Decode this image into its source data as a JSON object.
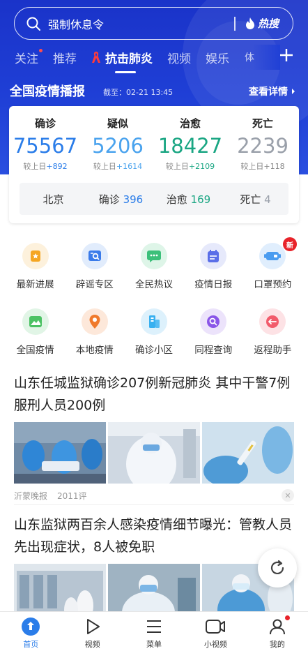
{
  "search": {
    "query": "强制休息令",
    "hot_label": "热搜"
  },
  "tabs": [
    {
      "label": "关注"
    },
    {
      "label": "推荐"
    },
    {
      "label": "抗击肺炎"
    },
    {
      "label": "视频"
    },
    {
      "label": "娱乐"
    },
    {
      "label": "体"
    }
  ],
  "report": {
    "title": "全国疫情播报",
    "timestamp": "截至：02-21 13:45",
    "more_label": "查看详情",
    "stats": [
      {
        "label": "确诊",
        "value": "75567",
        "delta_prefix": "较上日",
        "delta": "+892",
        "color": "#2b7de9"
      },
      {
        "label": "疑似",
        "value": "5206",
        "delta_prefix": "较上日",
        "delta": "+1614",
        "color": "#4aa3ee"
      },
      {
        "label": "治愈",
        "value": "18427",
        "delta_prefix": "较上日",
        "delta": "+2109",
        "color": "#1aa683"
      },
      {
        "label": "死亡",
        "value": "2239",
        "delta_prefix": "较上日",
        "delta": "+118",
        "color": "#9aa0aa"
      }
    ],
    "city": {
      "name": "北京",
      "confirmed_label": "确诊",
      "confirmed": "396",
      "cured_label": "治愈",
      "cured": "169",
      "dead_label": "死亡",
      "dead": "4"
    }
  },
  "features": [
    {
      "label": "最新进展",
      "icon": "bookmark-icon",
      "color": "#f5a623"
    },
    {
      "label": "辟谣专区",
      "icon": "search-doc-icon",
      "color": "#3a7bea"
    },
    {
      "label": "全民热议",
      "icon": "chat-bubble-icon",
      "color": "#3cc07a"
    },
    {
      "label": "疫情日报",
      "icon": "calendar-icon",
      "color": "#5a6ee8"
    },
    {
      "label": "口罩预约",
      "icon": "mask-icon",
      "color": "#4a9cf0",
      "badge": "新"
    },
    {
      "label": "全国疫情",
      "icon": "map-icon",
      "color": "#4cc264"
    },
    {
      "label": "本地疫情",
      "icon": "location-pin-icon",
      "color": "#f07a2b"
    },
    {
      "label": "确诊小区",
      "icon": "building-icon",
      "color": "#38b0f0"
    },
    {
      "label": "同程查询",
      "icon": "route-search-icon",
      "color": "#8a55e8"
    },
    {
      "label": "返程助手",
      "icon": "return-icon",
      "color": "#f25b6b"
    }
  ],
  "news": [
    {
      "title": "山东任城监狱确诊207例新冠肺炎 其中干警7例服刑人员200例",
      "source": "沂蒙晚报",
      "comments": "2011评"
    },
    {
      "title": "山东监狱两百余人感染疫情细节曝光：管教人员先出现症状，8人被免职"
    }
  ],
  "bottom_nav": [
    {
      "label": "首页",
      "icon": "home-icon"
    },
    {
      "label": "视频",
      "icon": "play-icon"
    },
    {
      "label": "菜单",
      "icon": "menu-icon"
    },
    {
      "label": "小视频",
      "icon": "camera-icon"
    },
    {
      "label": "我的",
      "icon": "user-icon"
    }
  ]
}
